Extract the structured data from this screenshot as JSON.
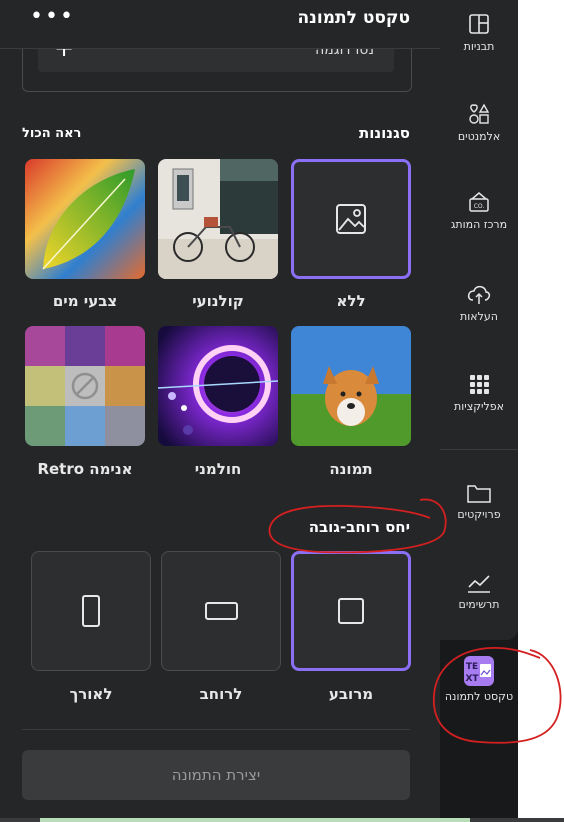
{
  "panel": {
    "title": "טקסט לתמונה",
    "more_icon": "ellipsis-icon",
    "more_label": "•••",
    "prompt_button_label": "נסו דוגמה",
    "prompt_plus": "+"
  },
  "styles": {
    "title": "סגנונות",
    "see_all": "ראה הכול",
    "items": [
      {
        "label": "ללא",
        "selected": true
      },
      {
        "label": "קולנועי",
        "selected": false
      },
      {
        "label": "צבעי מים",
        "selected": false
      },
      {
        "label": "תמונה",
        "selected": false
      },
      {
        "label": "חולמני",
        "selected": false
      },
      {
        "label": "Retro אנימה",
        "selected": false
      }
    ]
  },
  "aspect": {
    "title": "יחס רוחב-גובה",
    "items": [
      {
        "label": "מרובע",
        "selected": true
      },
      {
        "label": "לרוחב",
        "selected": false
      },
      {
        "label": "לאורך",
        "selected": false
      }
    ]
  },
  "generate_button": "יצירת התמונה",
  "rail": {
    "items": [
      {
        "label": "תבניות",
        "icon": "templates-icon"
      },
      {
        "label": "אלמנטים",
        "icon": "elements-icon"
      },
      {
        "label": "מרכז המותג",
        "icon": "brand-icon"
      },
      {
        "label": "העלאות",
        "icon": "upload-icon"
      },
      {
        "label": "אפליקציות",
        "icon": "apps-icon"
      },
      {
        "label": "פרויקטים",
        "icon": "folder-icon"
      },
      {
        "label": "תרשימים",
        "icon": "chart-icon"
      },
      {
        "label": "טקסט לתמונה",
        "icon": "text-to-image-icon"
      }
    ]
  },
  "colors": {
    "accent": "#8b6ff5",
    "panel": "#252627",
    "annotation": "#d42020"
  }
}
